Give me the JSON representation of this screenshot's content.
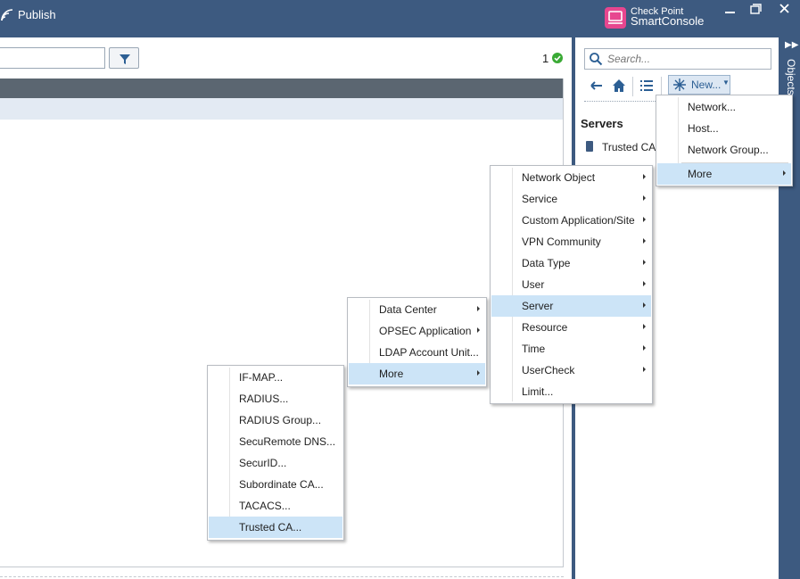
{
  "titlebar": {
    "publish_label": "Publish",
    "logo_line1": "Check Point",
    "logo_line2": "SmartConsole",
    "window_buttons": [
      "minimize-icon",
      "restore-icon",
      "close-icon"
    ],
    "colors": {
      "bar": "#3d5a80",
      "logo": "#e7468f"
    }
  },
  "main": {
    "count": "1",
    "status_icon": "check-circle-icon",
    "filter_icon": "filter-icon"
  },
  "objects_panel": {
    "search_placeholder": "Search...",
    "toolbar_icons": [
      "back-arrow-icon",
      "home-icon",
      "list-view-icon"
    ],
    "new_label": "New...",
    "section_title": "Servers",
    "items": [
      {
        "label": "Trusted CA",
        "icon": "server-icon"
      }
    ],
    "vertical_tab": "Objects"
  },
  "menus": {
    "new": [
      {
        "label": "Network...",
        "submenu": false
      },
      {
        "label": "Host...",
        "submenu": false
      },
      {
        "label": "Network Group...",
        "submenu": false
      },
      {
        "label": "More",
        "submenu": true,
        "highlighted": true
      }
    ],
    "more": [
      {
        "label": "Network Object",
        "submenu": true
      },
      {
        "label": "Service",
        "submenu": true
      },
      {
        "label": "Custom Application/Site",
        "submenu": true
      },
      {
        "label": "VPN Community",
        "submenu": true
      },
      {
        "label": "Data Type",
        "submenu": true
      },
      {
        "label": "User",
        "submenu": true
      },
      {
        "label": "Server",
        "submenu": true,
        "highlighted": true
      },
      {
        "label": "Resource",
        "submenu": true
      },
      {
        "label": "Time",
        "submenu": true
      },
      {
        "label": "UserCheck",
        "submenu": true
      },
      {
        "label": "Limit...",
        "submenu": false
      }
    ],
    "server": [
      {
        "label": "Data Center",
        "submenu": true
      },
      {
        "label": "OPSEC Application",
        "submenu": true
      },
      {
        "label": "LDAP Account Unit...",
        "submenu": false
      },
      {
        "label": "More",
        "submenu": true,
        "highlighted": true
      }
    ],
    "server_more": [
      {
        "label": "IF-MAP...",
        "submenu": false
      },
      {
        "label": "RADIUS...",
        "submenu": false
      },
      {
        "label": "RADIUS Group...",
        "submenu": false
      },
      {
        "label": "SecuRemote DNS...",
        "submenu": false
      },
      {
        "label": "SecurID...",
        "submenu": false
      },
      {
        "label": "Subordinate CA...",
        "submenu": false
      },
      {
        "label": "TACACS...",
        "submenu": false
      },
      {
        "label": "Trusted CA...",
        "submenu": false,
        "highlighted": true
      }
    ],
    "highlight_color": "#cce4f7"
  }
}
